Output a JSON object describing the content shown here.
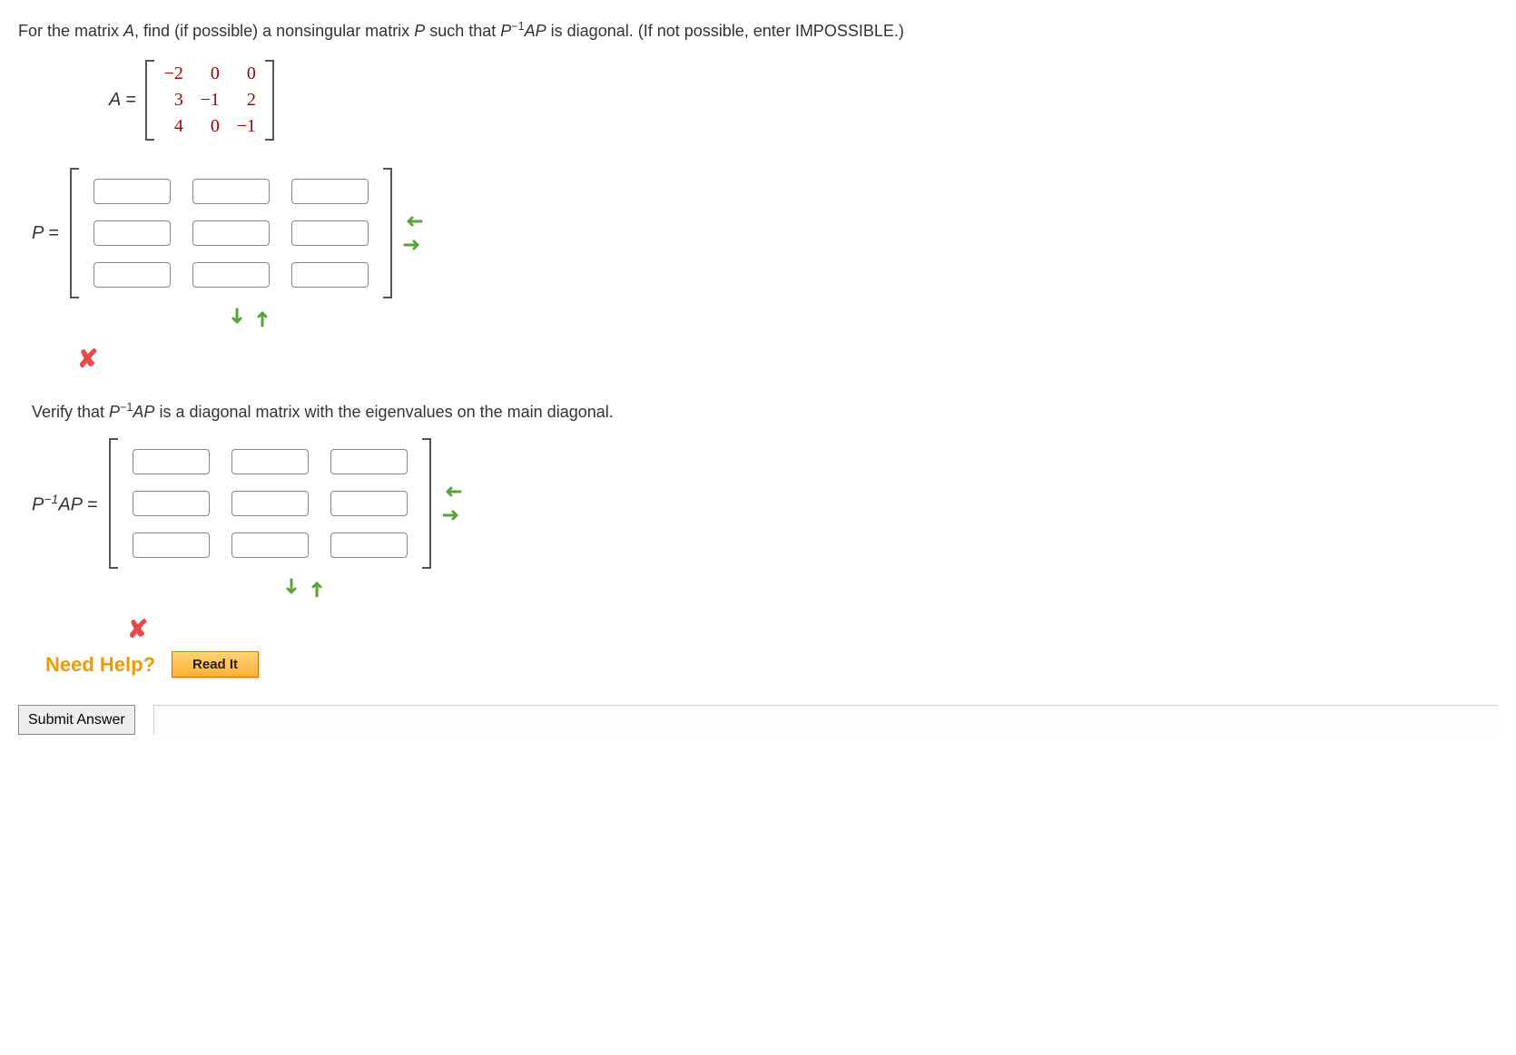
{
  "question": {
    "prompt_before_A": "For the matrix ",
    "var_A": "A",
    "prompt_mid1": ", find (if possible) a nonsingular matrix ",
    "var_P": "P",
    "prompt_mid2": " such that ",
    "expr_part1": "P",
    "expr_sup": "−1",
    "expr_part2": "AP",
    "prompt_mid3": " is diagonal. (If not possible, enter IMPOSSIBLE.)"
  },
  "matrix_A_label": "A =",
  "matrix_A": [
    [
      "−2",
      "0",
      "0"
    ],
    [
      "3",
      "−1",
      "2"
    ],
    [
      "4",
      "0",
      "−1"
    ]
  ],
  "P_label": "P =",
  "P_values": [
    [
      "",
      "",
      ""
    ],
    [
      "",
      "",
      ""
    ],
    [
      "",
      "",
      ""
    ]
  ],
  "verify_text_before": "Verify that ",
  "verify_text_after": " is a diagonal matrix with the eigenvalues on the main diagonal.",
  "D_label_p": "P",
  "D_label_sup": "−1",
  "D_label_ap": "AP =",
  "D_values": [
    [
      "",
      "",
      ""
    ],
    [
      "",
      "",
      ""
    ],
    [
      "",
      "",
      ""
    ]
  ],
  "need_help_label": "Need Help?",
  "read_it_label": "Read It",
  "submit_label": "Submit Answer"
}
